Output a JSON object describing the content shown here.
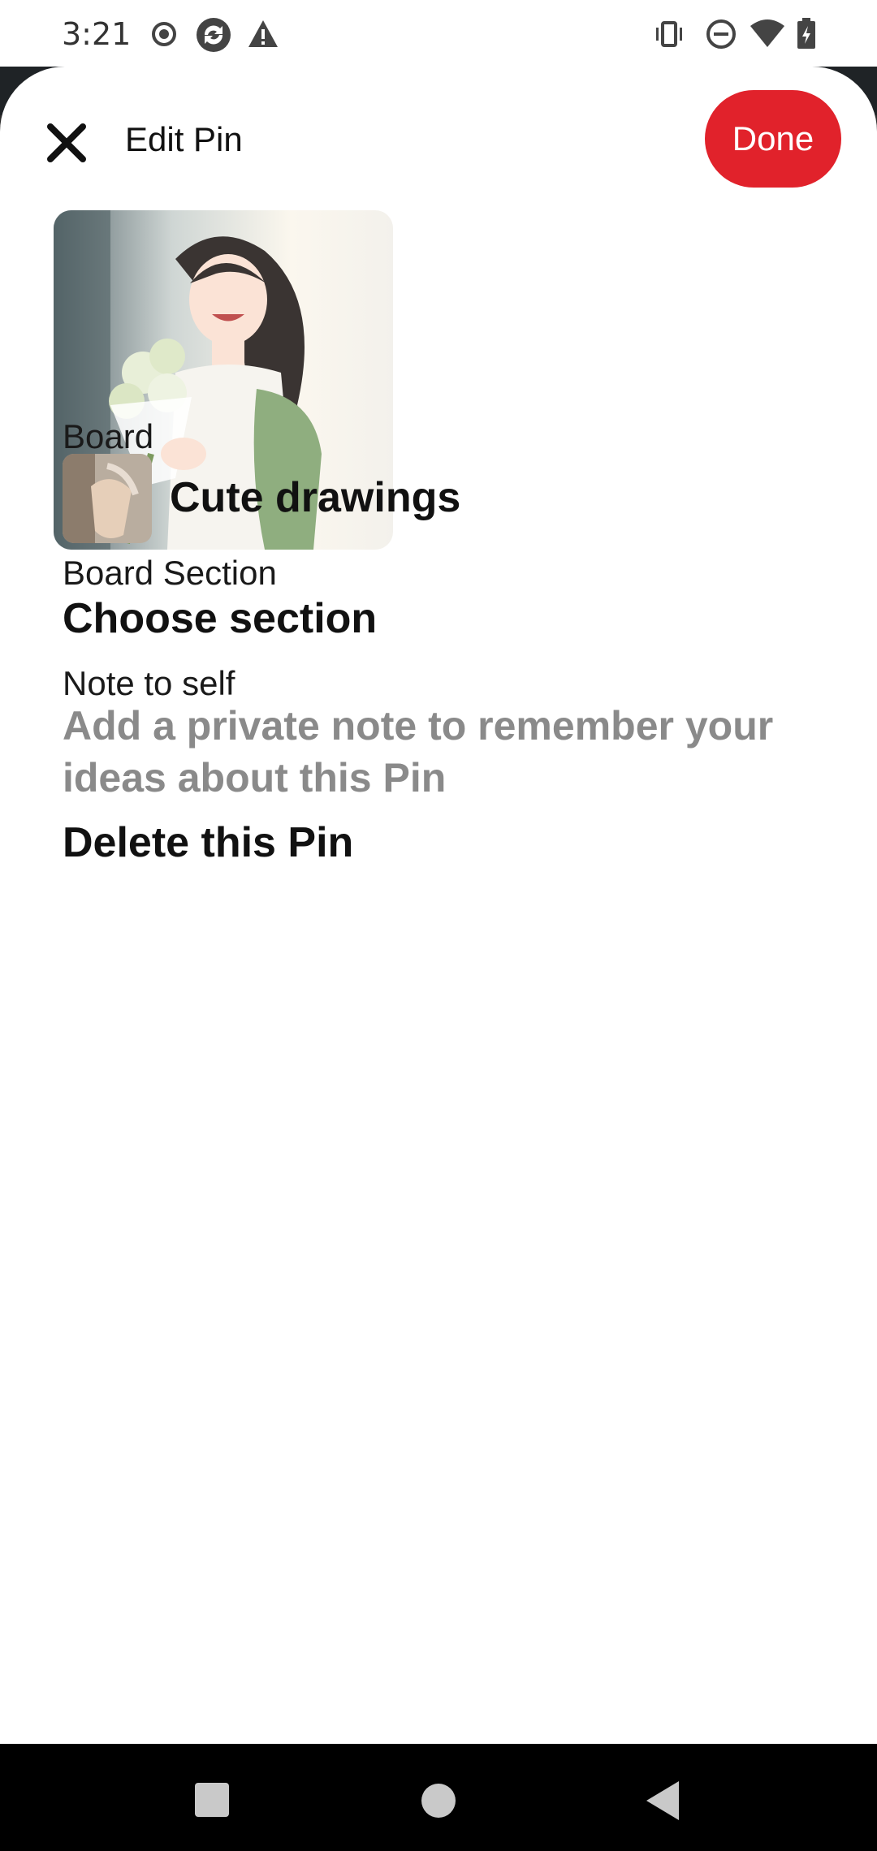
{
  "status_bar": {
    "time": "3:21",
    "left_icons": [
      "record-icon",
      "sync-icon",
      "warning-icon"
    ],
    "right_icons": [
      "vibrate-icon",
      "do-not-disturb-icon",
      "wifi-icon",
      "battery-icon"
    ]
  },
  "header": {
    "title": "Edit Pin",
    "done_label": "Done",
    "close_icon": "close-icon"
  },
  "colors": {
    "accent": "#e1222b",
    "placeholder": "#8a8a8a"
  },
  "board": {
    "label": "Board",
    "name": "Cute drawings"
  },
  "section": {
    "label": "Board Section",
    "value": "Choose section"
  },
  "note": {
    "label": "Note to self",
    "placeholder": "Add a private note to remember your ideas about this Pin"
  },
  "delete_label": "Delete this Pin",
  "nav": {
    "icons": [
      "recents-icon",
      "home-icon",
      "back-icon"
    ]
  }
}
